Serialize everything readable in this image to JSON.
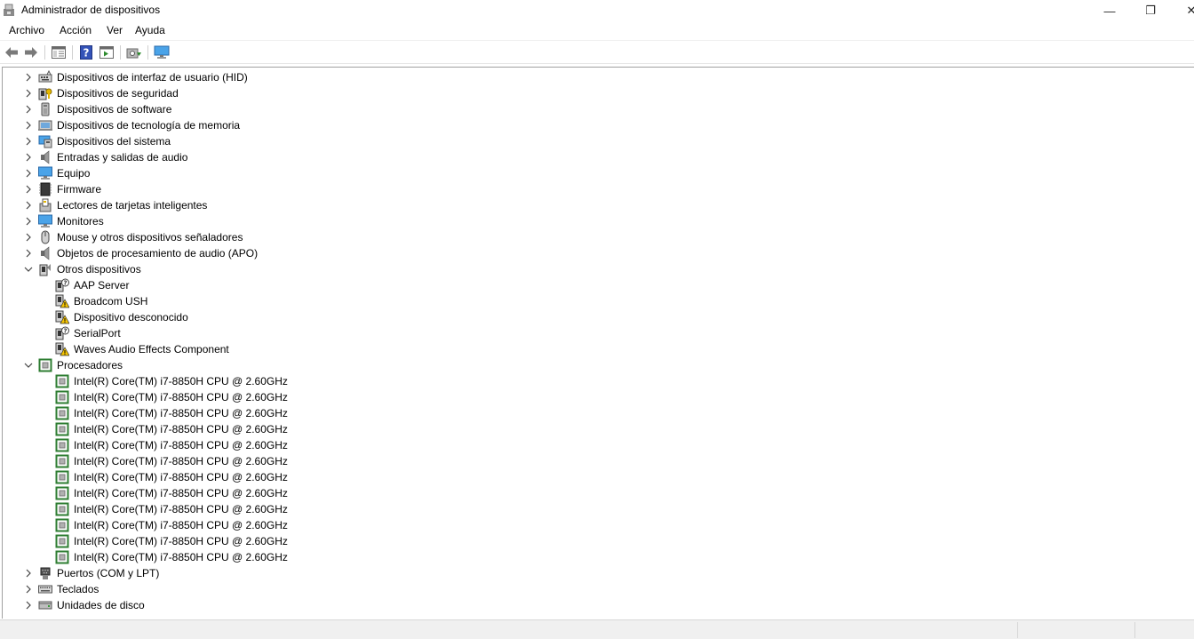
{
  "window": {
    "title": "Administrador de dispositivos",
    "min_glyph": "—",
    "max_glyph": "❐",
    "close_glyph": "✕"
  },
  "menu": [
    "Archivo",
    "Acción",
    "Ver",
    "Ayuda"
  ],
  "toolbar": {
    "icons": [
      "back-arrow-icon",
      "forward-arrow-icon",
      "properties-pane-icon",
      "help-icon",
      "action-pane-icon",
      "scan-hardware-icon",
      "monitor-icon"
    ]
  },
  "tree": {
    "top_categories": [
      {
        "label": "Dispositivos de interfaz de usuario (HID)",
        "icon": "hid-icon"
      },
      {
        "label": "Dispositivos de seguridad",
        "icon": "security-device-icon"
      },
      {
        "label": "Dispositivos de software",
        "icon": "software-device-icon"
      },
      {
        "label": "Dispositivos de tecnología de memoria",
        "icon": "memory-technology-icon"
      },
      {
        "label": "Dispositivos del sistema",
        "icon": "system-device-icon"
      },
      {
        "label": "Entradas y salidas de audio",
        "icon": "speaker-icon"
      },
      {
        "label": "Equipo",
        "icon": "computer-icon"
      },
      {
        "label": "Firmware",
        "icon": "firmware-chip-icon"
      },
      {
        "label": "Lectores de tarjetas inteligentes",
        "icon": "smart-card-reader-icon"
      },
      {
        "label": "Monitores",
        "icon": "monitor-icon"
      },
      {
        "label": "Mouse y otros dispositivos señaladores",
        "icon": "mouse-icon"
      },
      {
        "label": "Objetos de procesamiento de audio (APO)",
        "icon": "speaker-icon"
      }
    ],
    "other_devices": {
      "label": "Otros dispositivos",
      "icon": "unknown-device-icon",
      "children": [
        {
          "label": "AAP Server",
          "icon": "unknown-device-question-icon"
        },
        {
          "label": "Broadcom USH",
          "icon": "device-warning-icon"
        },
        {
          "label": "Dispositivo desconocido",
          "icon": "device-warning-icon"
        },
        {
          "label": "SerialPort",
          "icon": "unknown-device-question-icon"
        },
        {
          "label": "Waves Audio Effects Component",
          "icon": "device-warning-icon"
        }
      ]
    },
    "processors": {
      "label": "Procesadores",
      "icon": "processor-icon",
      "children": [
        "Intel(R) Core(TM) i7-8850H CPU @ 2.60GHz",
        "Intel(R) Core(TM) i7-8850H CPU @ 2.60GHz",
        "Intel(R) Core(TM) i7-8850H CPU @ 2.60GHz",
        "Intel(R) Core(TM) i7-8850H CPU @ 2.60GHz",
        "Intel(R) Core(TM) i7-8850H CPU @ 2.60GHz",
        "Intel(R) Core(TM) i7-8850H CPU @ 2.60GHz",
        "Intel(R) Core(TM) i7-8850H CPU @ 2.60GHz",
        "Intel(R) Core(TM) i7-8850H CPU @ 2.60GHz",
        "Intel(R) Core(TM) i7-8850H CPU @ 2.60GHz",
        "Intel(R) Core(TM) i7-8850H CPU @ 2.60GHz",
        "Intel(R) Core(TM) i7-8850H CPU @ 2.60GHz",
        "Intel(R) Core(TM) i7-8850H CPU @ 2.60GHz"
      ]
    },
    "bottom_categories": [
      {
        "label": "Puertos (COM y LPT)",
        "icon": "port-icon"
      },
      {
        "label": "Teclados",
        "icon": "keyboard-icon"
      },
      {
        "label": "Unidades de disco",
        "icon": "disk-drive-icon"
      }
    ]
  },
  "colors": {
    "warning": "#f5c400",
    "chip_green": "#2e7d32",
    "monitor_blue": "#3a8fd8",
    "tree_border": "#a0a0a0"
  }
}
